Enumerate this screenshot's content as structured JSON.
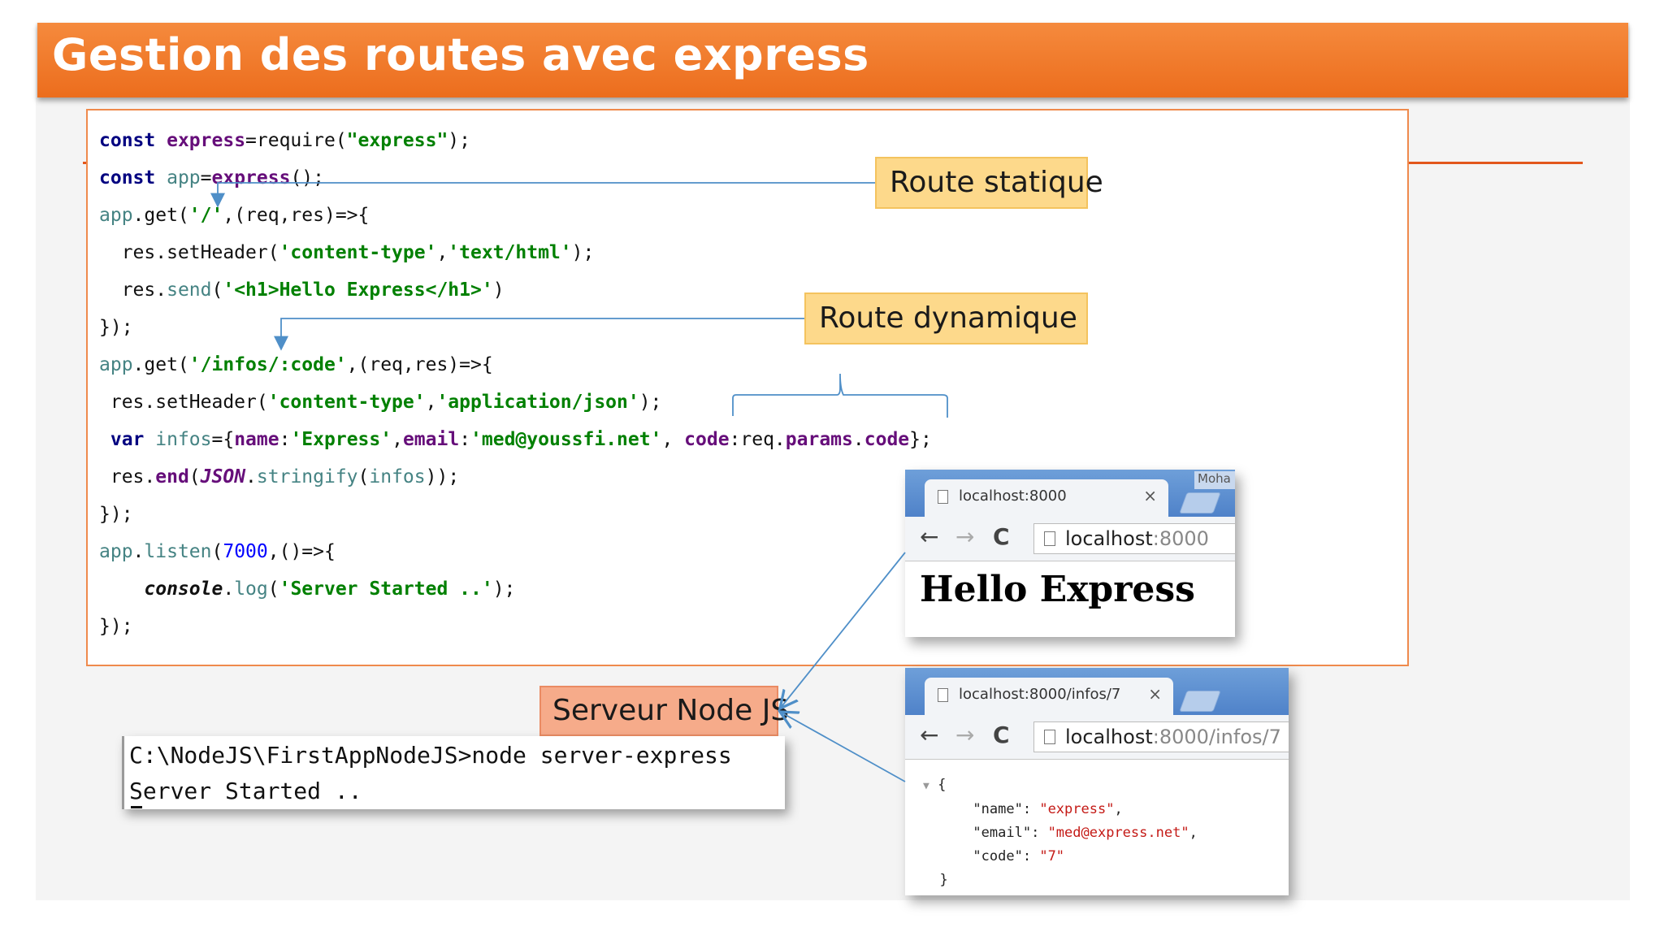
{
  "slide": {
    "title": "Gestion des routes avec express"
  },
  "code": {
    "line1": {
      "kw": "const",
      "name": "express",
      "rest1": "=require(",
      "str": "\"express\"",
      "rest2": ");"
    },
    "line2": {
      "kw": "const",
      "name": "app",
      "rest1": "=",
      "call": "express",
      "rest2": "();"
    },
    "line3": {
      "obj": "app",
      "rest1": ".get(",
      "str": "'/'",
      "rest2": ",(req,res)=>{"
    },
    "line4": {
      "rest1": "  res.setHeader(",
      "str1": "'content-type'",
      "comma": ",",
      "str2": "'text/html'",
      "rest2": ");"
    },
    "line5": {
      "rest1": "  res.",
      "method": "send",
      "rest2": "(",
      "str": "'<h1>Hello Express</h1>'",
      "rest3": ")"
    },
    "line6": "});",
    "line7": {
      "obj": "app",
      "rest1": ".get(",
      "str": "'/infos/:code'",
      "rest2": ",(req,res)=>{"
    },
    "line8": {
      "rest1": " res.setHeader(",
      "str1": "'content-type'",
      "comma": ",",
      "str2": "'application/json'",
      "rest2": ");"
    },
    "line9": {
      "kw": " var",
      "sp": " ",
      "name": "infos",
      "rest1": "={",
      "k1": "name",
      "c1": ":",
      "v1": "'Express'",
      "c2": ",",
      "k2": "email",
      "c3": ":",
      "v2": "'med@youssfi.net'",
      "c4": ", ",
      "k3": "code",
      "c5": ":req.",
      "k4": "params",
      "c6": ".",
      "k5": "code",
      "rest2": "};"
    },
    "line10": {
      "rest1": " res.",
      "method": "end",
      "rest2": "(",
      "json": "JSON",
      "rest3": ".",
      "fn": "stringify",
      "rest4": "(",
      "arg": "infos",
      "rest5": "));"
    },
    "line11": "});",
    "line12": {
      "obj": "app",
      "rest1": ".",
      "fn": "listen",
      "rest2": "(",
      "num": "7000",
      "rest3": ",()=>{"
    },
    "line13": {
      "indent": "    ",
      "obj": "console",
      "rest1": ".",
      "fn": "log",
      "rest2": "(",
      "str": "'Server Started ..'",
      "rest3": ");"
    },
    "line14": "});"
  },
  "callouts": {
    "static_route": "Route statique",
    "dynamic_route": "Route dynamique",
    "node_server": "Serveur Node JS"
  },
  "browser1": {
    "tab_title": "localhost:8000",
    "url_host": "localhost",
    "url_rest": ":8000",
    "user_tag": "Moha",
    "content": "Hello Express"
  },
  "browser2": {
    "tab_title": "localhost:8000/infos/7",
    "url_host": "localhost",
    "url_rest": ":8000/infos/7",
    "json_open": "{",
    "k_name": "\"name\"",
    "v_name": "\"express\"",
    "k_email": "\"email\"",
    "v_email": "\"med@express.net\"",
    "k_code": "\"code\"",
    "v_code": "\"7\"",
    "json_close": "}"
  },
  "terminal": {
    "line1": "C:\\NodeJS\\FirstAppNodeJS>node server-express",
    "line2": "Server Started .."
  },
  "icons": {
    "back": "←",
    "forward": "→",
    "reload": "C",
    "close": "×",
    "collapse": "▼"
  },
  "colors": {
    "title_bar": "#ec6d1d",
    "callout_yellow": "#fdd98b",
    "callout_pink": "#f6ab8a",
    "arrow": "#4f8fc8"
  }
}
